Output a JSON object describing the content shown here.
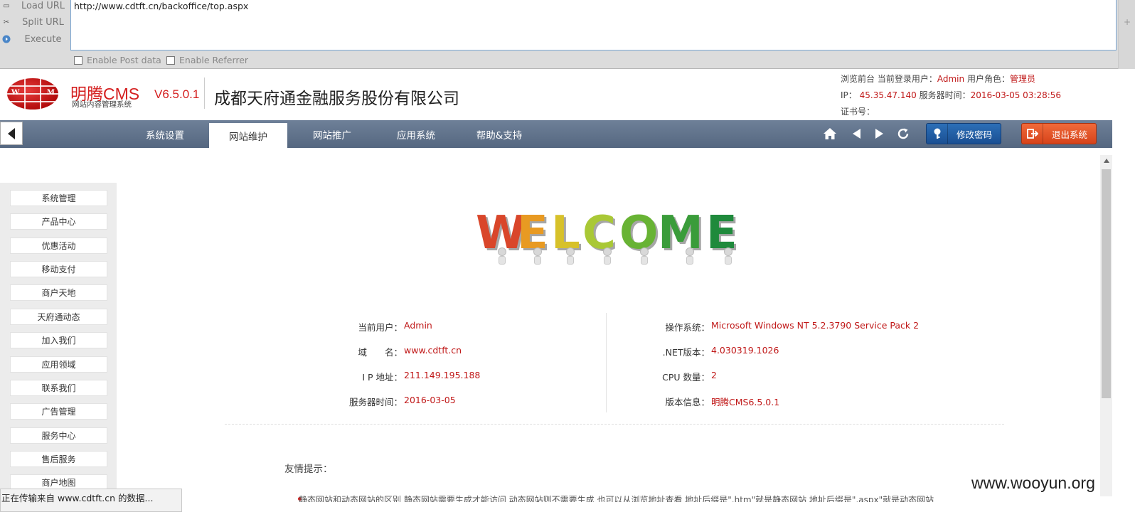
{
  "hackbar": {
    "load_url": "Load URL",
    "split_url": "Split URL",
    "execute": "Execute",
    "url_value": "http://www.cdtft.cn/backoffice/top.aspx",
    "enable_post": "Enable Post data",
    "enable_referrer": "Enable Referrer"
  },
  "header": {
    "brand": "明腾CMS",
    "brand_sub": "网站内容管理系统",
    "version": "V6.5.0.1",
    "company": "成都天府通金融服务股份有限公司",
    "browse_front": "浏览前台",
    "current_user_label": "当前登录用户：",
    "current_user": "Admin",
    "role_label": "用户角色：",
    "role": "管理员",
    "ip_label": "IP：",
    "ip": "45.35.47.140",
    "server_time_label": "服务器时间：",
    "server_time": "2016-03-05 03:28:56",
    "cert_label": "证书号："
  },
  "nav": {
    "tabs": [
      "系统设置",
      "网站维护",
      "网站推广",
      "应用系统",
      "帮助&支持"
    ],
    "active_tab": 1,
    "change_password": "修改密码",
    "logout": "退出系统"
  },
  "sidebar": {
    "items": [
      "系统管理",
      "产品中心",
      "优惠活动",
      "移动支付",
      "商户天地",
      "天府通动态",
      "加入我们",
      "应用领域",
      "联系我们",
      "广告管理",
      "服务中心",
      "售后服务",
      "商户地图"
    ]
  },
  "welcome": {
    "letters": [
      "W",
      "E",
      "L",
      "C",
      "O",
      "M",
      "E"
    ],
    "colors": [
      "#d9462a",
      "#e89a22",
      "#d7c12a",
      "#a9c836",
      "#68b334",
      "#3a9c3a",
      "#1f8a3c"
    ]
  },
  "info": {
    "left": [
      {
        "k": "当前用户：",
        "v": "Admin"
      },
      {
        "k": "域　　名：",
        "v": "www.cdtft.cn"
      },
      {
        "k": "I P 地址：",
        "v": "211.149.195.188"
      },
      {
        "k": "服务器时间：",
        "v": "2016-03-05"
      }
    ],
    "right": [
      {
        "k": "操作系统：",
        "v": "Microsoft Windows NT 5.2.3790 Service Pack 2"
      },
      {
        "k": ".NET版本：",
        "v": "4.030319.1026"
      },
      {
        "k": "CPU 数量：",
        "v": "2"
      },
      {
        "k": "版本信息：",
        "v": "明腾CMS6.5.0.1"
      }
    ]
  },
  "tips": {
    "title": "友情提示：",
    "line1": "静态网站和动态网站的区别 静态网站需要生成才能访问 动态网站则不需要生成 也可以从浏览地址查看 地址后缀是\".htm\"就是静态网站 地址后缀是\".aspx\"就是动态网站"
  },
  "status_bar": "正在传输来自 www.cdtft.cn 的数据...",
  "watermark": "www.wooyun.org"
}
